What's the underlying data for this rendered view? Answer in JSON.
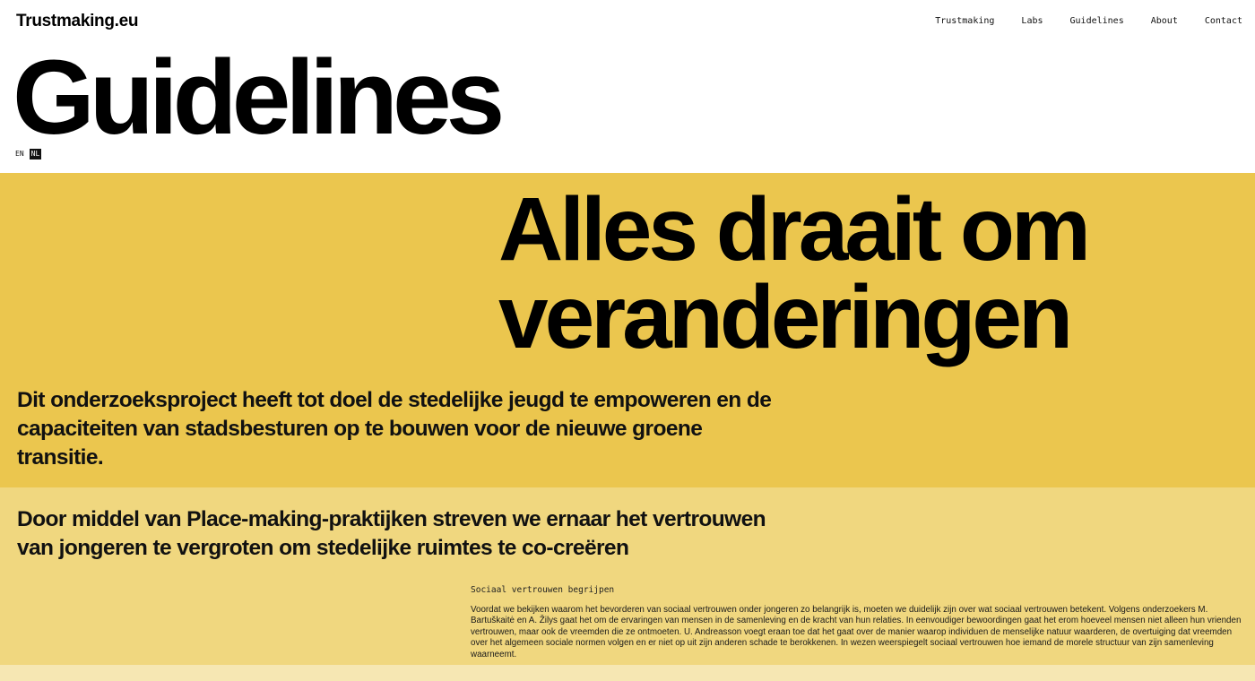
{
  "header": {
    "brand": "Trustmaking.eu",
    "nav": [
      {
        "label": "Trustmaking"
      },
      {
        "label": "Labs"
      },
      {
        "label": "Guidelines"
      },
      {
        "label": "About"
      },
      {
        "label": "Contact"
      }
    ]
  },
  "page": {
    "title": "Guidelines",
    "languages": [
      {
        "code": "EN",
        "active": false
      },
      {
        "code": "NL",
        "active": true
      }
    ]
  },
  "hero": {
    "title": "Alles draait om veranderingen",
    "lead": "Dit onderzoeksproject heeft tot doel de stedelijke jeugd te empoweren en de capaciteiten van stadsbesturen op te bouwen voor de nieuwe groene transitie."
  },
  "section": {
    "lead": "Door middel van Place-making-praktijken streven we ernaar het vertrouwen van jongeren te vergroten om stedelijke ruimtes te co-creëren",
    "heading": "Sociaal vertrouwen begrijpen",
    "body": "Voordat we bekijken waarom het bevorderen van sociaal vertrouwen onder jongeren zo belangrijk is, moeten we duidelijk zijn over wat sociaal vertrouwen betekent. Volgens onderzoekers M. Bartuškaitė en A. Žilys gaat het om de ervaringen van mensen in de samenleving en de kracht van hun relaties. In eenvoudiger bewoordingen gaat het erom hoeveel mensen niet alleen hun vrienden vertrouwen, maar ook de vreemden die ze ontmoeten. U. Andreasson voegt eraan toe dat het gaat over de manier waarop individuen de menselijke natuur waarderen, de overtuiging dat vreemden over het algemeen sociale normen volgen en er niet op uit zijn anderen schade te berokkenen. In wezen weerspiegelt sociaal vertrouwen hoe iemand de morele structuur van zijn samenleving waarneemt."
  },
  "colors": {
    "hero_bg": "#ebc64e",
    "band_bg": "#f0d77f",
    "footer_bg": "#f6e7b3",
    "text": "#0a0a0a"
  }
}
